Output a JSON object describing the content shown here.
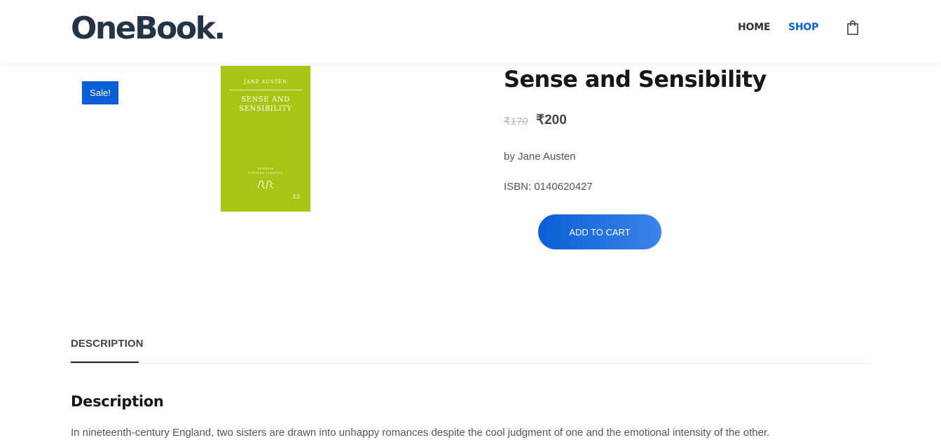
{
  "header": {
    "logo": "OneBook.",
    "nav": {
      "home": "HOME",
      "shop": "SHOP"
    },
    "cart_icon": "shopping-bag-icon"
  },
  "product": {
    "badge": "Sale!",
    "cover": {
      "author": "JANE AUSTEN",
      "title_line1": "SENSE AND",
      "title_line2": "SENSIBILITY",
      "publisher_line1": "PENGUIN",
      "publisher_line2": "POPULAR CLASSICS",
      "price": "£2",
      "background_color": "#a7c614"
    },
    "title": "Sense and Sensibility",
    "price_old": "₹170",
    "price_new": "₹200",
    "author_line": "by Jane Austen",
    "isbn_line": "ISBN: 0140620427",
    "add_to_cart": "ADD TO CART"
  },
  "tabs": {
    "description": "DESCRIPTION"
  },
  "description": {
    "heading": "Description",
    "text": "In nineteenth-century England, two sisters are drawn into unhappy romances despite the cool judgment of one and the emotional intensity of the other."
  },
  "colors": {
    "accent": "#0a5fd6",
    "heading": "#14161c",
    "logo": "#233449"
  }
}
